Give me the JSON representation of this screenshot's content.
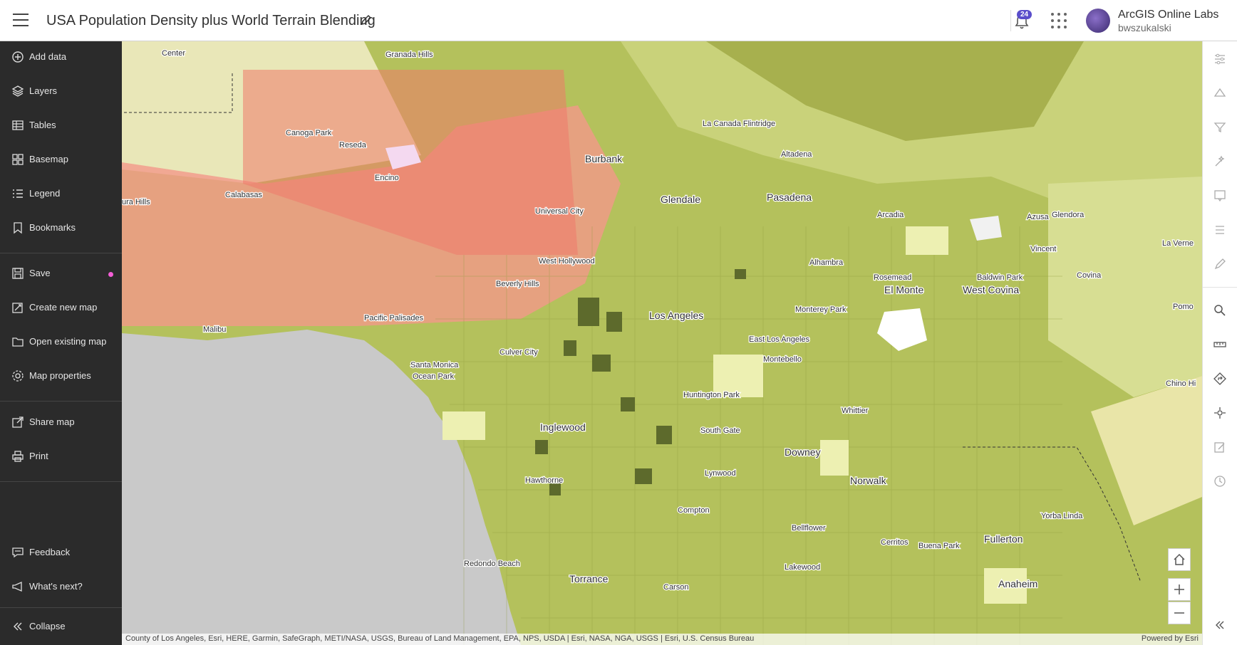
{
  "header": {
    "title": "USA Population Density plus World Terrain Blending",
    "notification_count": "24",
    "org_name": "ArcGIS Online Labs",
    "username": "bwszukalski"
  },
  "sidebar": {
    "items": [
      {
        "label": "Add data",
        "icon": "add-data-icon"
      },
      {
        "label": "Layers",
        "icon": "layers-icon"
      },
      {
        "label": "Tables",
        "icon": "table-icon"
      },
      {
        "label": "Basemap",
        "icon": "basemap-icon"
      },
      {
        "label": "Legend",
        "icon": "legend-icon"
      },
      {
        "label": "Bookmarks",
        "icon": "bookmark-icon"
      },
      {
        "label": "Save",
        "icon": "save-icon"
      },
      {
        "label": "Create new map",
        "icon": "create-map-icon"
      },
      {
        "label": "Open existing map",
        "icon": "folder-icon"
      },
      {
        "label": "Map properties",
        "icon": "gear-icon"
      },
      {
        "label": "Share map",
        "icon": "share-icon"
      },
      {
        "label": "Print",
        "icon": "print-icon"
      },
      {
        "label": "Feedback",
        "icon": "feedback-icon"
      },
      {
        "label": "What's next?",
        "icon": "megaphone-icon"
      },
      {
        "label": "Collapse",
        "icon": "collapse-icon"
      }
    ]
  },
  "map": {
    "labels": [
      "Center",
      "Granada Hills",
      "Canoga Park",
      "Reseda",
      "Encino",
      "Calabasas",
      "ura Hills",
      "Burbank",
      "La Canada Flintridge",
      "Altadena",
      "Glendale",
      "Pasadena",
      "Universal City",
      "Arcadia",
      "Azusa",
      "Glendora",
      "La Verne",
      "Vincent",
      "Covina",
      "Baldwin Park",
      "El Monte",
      "West Covina",
      "Rosemead",
      "Alhambra",
      "Monterey Park",
      "West Hollywood",
      "Beverly Hills",
      "Los Angeles",
      "Malibu",
      "Pacific Palisades",
      "Culver City",
      "Santa Monica",
      "Ocean Park",
      "East Los Angeles",
      "Montebello",
      "Pomo",
      "Chino Hi",
      "Huntington Park",
      "Whittier",
      "South Gate",
      "Inglewood",
      "Downey",
      "Lynwood",
      "Norwalk",
      "Hawthorne",
      "Compton",
      "Bellflower",
      "Cerritos",
      "Buena Park",
      "Fullerton",
      "Yorba Linda",
      "Lakewood",
      "Redondo Beach",
      "Torrance",
      "Carson",
      "Anaheim"
    ],
    "attribution": "County of Los Angeles, Esri, HERE, Garmin, SafeGraph, METI/NASA, USGS, Bureau of Land Management, EPA, NPS, USDA | Esri, NASA, NGA, USGS | Esri, U.S. Census Bureau",
    "powered_by": "Powered by Esri"
  },
  "right_toolbar": {
    "tools": [
      "properties-icon",
      "styles-icon",
      "filter-icon",
      "effects-icon",
      "popups-icon",
      "labels-icon",
      "sketch-icon",
      "search-icon",
      "measure-icon",
      "directions-icon",
      "location-icon",
      "edit-icon",
      "time-icon"
    ]
  },
  "colors": {
    "sidebar_bg": "#2b2b2b",
    "water": "#c8c8c8",
    "density_low": "#f1efb0",
    "density_mid": "#a7b548",
    "density_high": "#5c6b2b",
    "highlight": "#f36a6a"
  }
}
